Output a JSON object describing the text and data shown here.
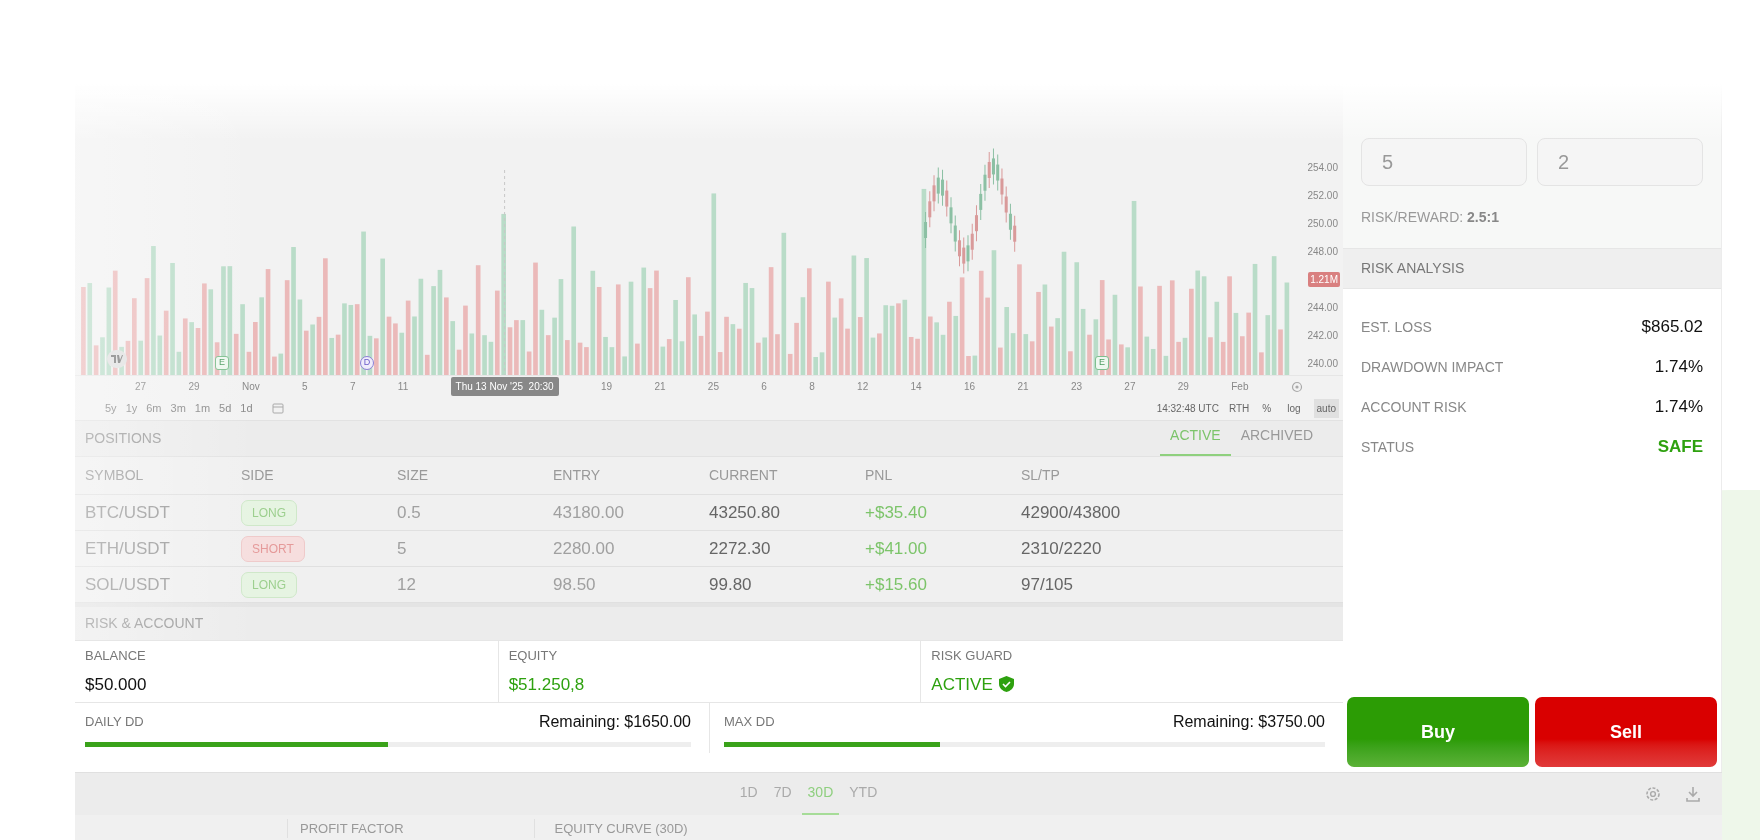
{
  "chart": {
    "price_ticks": [
      "254.00",
      "252.00",
      "250.00",
      "248.00",
      "1.21M",
      "244.00",
      "242.00",
      "240.00"
    ],
    "date_labels": [
      {
        "label": "27",
        "kind": "date"
      },
      {
        "label": "29",
        "kind": "date"
      },
      {
        "label": "Nov",
        "kind": "date"
      },
      {
        "label": "5",
        "kind": "date"
      },
      {
        "label": "7",
        "kind": "date"
      },
      {
        "label": "11",
        "kind": "date"
      },
      {
        "label": "Thu 13 Nov '25  20:30",
        "kind": "cursor"
      },
      {
        "label": "19",
        "kind": "date"
      },
      {
        "label": "21",
        "kind": "date"
      },
      {
        "label": "25",
        "kind": "date"
      },
      {
        "label": "6",
        "kind": "date"
      },
      {
        "label": "8",
        "kind": "date"
      },
      {
        "label": "12",
        "kind": "date"
      },
      {
        "label": "14",
        "kind": "date"
      },
      {
        "label": "16",
        "kind": "date"
      },
      {
        "label": "21",
        "kind": "date"
      },
      {
        "label": "23",
        "kind": "date"
      },
      {
        "label": "27",
        "kind": "date"
      },
      {
        "label": "29",
        "kind": "date"
      },
      {
        "label": "Feb",
        "kind": "date"
      }
    ],
    "markers": [
      {
        "label": "E",
        "kind": "earnings"
      },
      {
        "label": "D",
        "kind": "dividend"
      },
      {
        "label": "E",
        "kind": "earnings"
      }
    ],
    "ranges": [
      "5y",
      "1y",
      "6m",
      "3m",
      "1m",
      "5d",
      "1d"
    ],
    "time": "14:32:48 UTC",
    "session": "RTH",
    "scale_options": [
      {
        "label": "%",
        "selected": false
      },
      {
        "label": "log",
        "selected": false
      },
      {
        "label": "auto",
        "selected": true
      }
    ]
  },
  "order_form": {
    "fields": [
      {
        "placeholder": "5"
      },
      {
        "placeholder": "2"
      }
    ],
    "risk_reward_label": "RISK/REWARD:",
    "risk_reward": "2.5:1"
  },
  "risk_analysis": {
    "title": "RISK ANALYSIS",
    "rows": [
      {
        "label": "EST. LOSS",
        "value": "$865.02",
        "kind": "plain"
      },
      {
        "label": "DRAWDOWN IMPACT",
        "value": "1.74%",
        "kind": "plain"
      },
      {
        "label": "ACCOUNT RISK",
        "value": "1.74%",
        "kind": "plain"
      },
      {
        "label": "STATUS",
        "value": "SAFE",
        "kind": "status"
      }
    ]
  },
  "positions": {
    "title": "POSITIONS",
    "tabs": [
      {
        "label": "ACTIVE",
        "selected": true
      },
      {
        "label": "ARCHIVED",
        "selected": false
      }
    ],
    "columns": [
      "SYMBOL",
      "SIDE",
      "SIZE",
      "ENTRY",
      "CURRENT",
      "PNL",
      "SL/TP"
    ],
    "rows": [
      {
        "symbol": "BTC/USDT",
        "side": "LONG",
        "kind": "long",
        "size": "0.5",
        "entry": "43180.00",
        "current": "43250.80",
        "pnl": "+$35.40",
        "sltp": "42900/43800"
      },
      {
        "symbol": "ETH/USDT",
        "side": "SHORT",
        "kind": "short",
        "size": "5",
        "entry": "2280.00",
        "current": "2272.30",
        "pnl": "+$41.00",
        "sltp": "2310/2220"
      },
      {
        "symbol": "SOL/USDT",
        "side": "LONG",
        "kind": "long",
        "size": "12",
        "entry": "98.50",
        "current": "99.80",
        "pnl": "+$15.60",
        "sltp": "97/105"
      }
    ]
  },
  "account": {
    "title": "RISK & ACCOUNT",
    "cards": [
      {
        "label": "BALANCE",
        "value": "$50.000",
        "kind": "plain"
      },
      {
        "label": "EQUITY",
        "value": "$51.250,8",
        "kind": "positive"
      },
      {
        "label": "RISK GUARD",
        "value": "ACTIVE",
        "kind": "guard"
      }
    ],
    "drawdowns": [
      {
        "label": "DAILY DD",
        "remaining": "Remaining: $1650.00",
        "level": 0.5
      },
      {
        "label": "MAX DD",
        "remaining": "Remaining: $3750.00",
        "level": 0.36
      }
    ]
  },
  "actions": [
    {
      "label": "Buy",
      "kind": "buy"
    },
    {
      "label": "Sell",
      "kind": "sell"
    }
  ],
  "periods": [
    {
      "label": "1D",
      "selected": false
    },
    {
      "label": "7D",
      "selected": false
    },
    {
      "label": "30D",
      "selected": true
    },
    {
      "label": "YTD",
      "selected": false
    }
  ],
  "stats_headers": [
    "PROFIT FACTOR",
    "EQUITY CURVE (30D)"
  ]
}
